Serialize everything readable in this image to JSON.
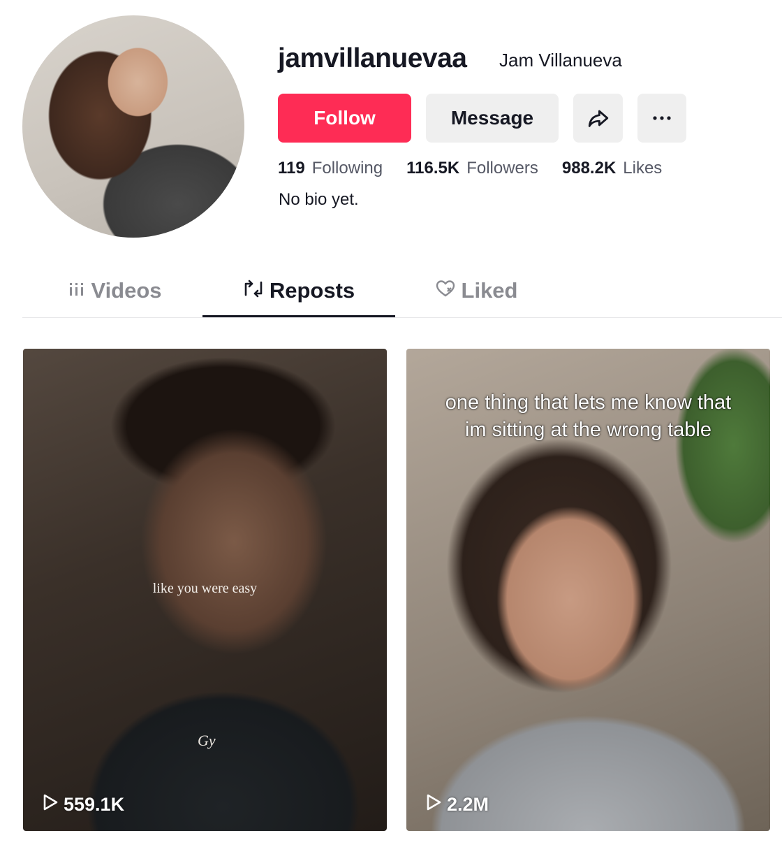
{
  "profile": {
    "handle": "jamvillanuevaa",
    "nickname": "Jam Villanueva",
    "bio": "No bio yet."
  },
  "buttons": {
    "follow": "Follow",
    "message": "Message"
  },
  "stats": [
    {
      "value": "119",
      "label": "Following"
    },
    {
      "value": "116.5K",
      "label": "Followers"
    },
    {
      "value": "988.2K",
      "label": "Likes"
    }
  ],
  "tabs": [
    {
      "label": "Videos",
      "icon": "grid-icon",
      "active": false
    },
    {
      "label": "Reposts",
      "icon": "repost-icon",
      "active": true
    },
    {
      "label": "Liked",
      "icon": "heart-icon",
      "active": false
    }
  ],
  "videos": [
    {
      "overlay_text": "like you were easy",
      "views": "559.1K"
    },
    {
      "overlay_text": "one thing that lets me know that im sitting at the wrong table",
      "views": "2.2M"
    }
  ],
  "colors": {
    "accent": "#fe2c55",
    "secondary_button": "#efefef",
    "text": "#161823",
    "muted": "#8a8b91"
  }
}
